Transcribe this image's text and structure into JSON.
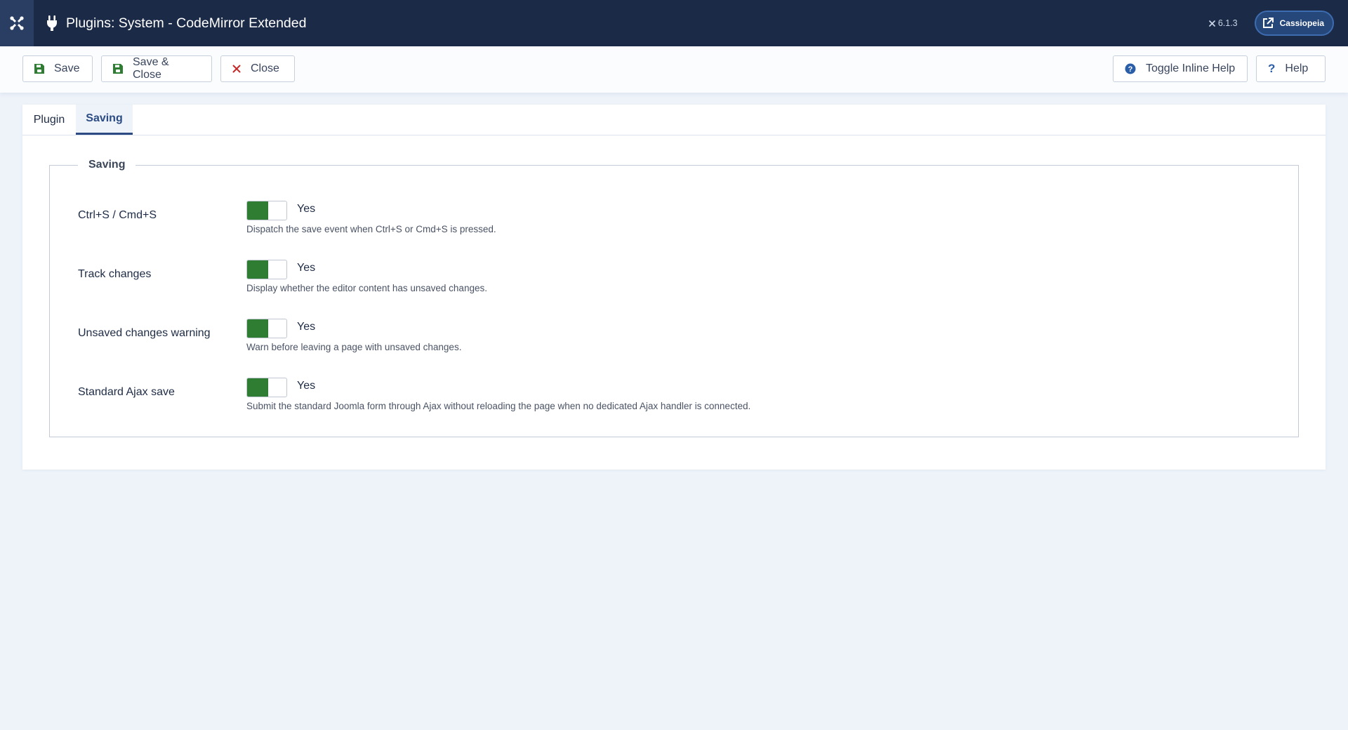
{
  "header": {
    "title": "Plugins: System - CodeMirror Extended",
    "version": "6.1.3",
    "site_name": "Cassiopeia",
    "icons": [
      "joomla-logo-icon",
      "plug-icon",
      "joomla-small-icon",
      "external-link-icon"
    ]
  },
  "toolbar": {
    "save_label": "Save",
    "save_close_label": "Save & Close",
    "close_label": "Close",
    "toggle_help_label": "Toggle Inline Help",
    "help_label": "Help"
  },
  "tabs": [
    {
      "label": "Plugin",
      "active": false
    },
    {
      "label": "Saving",
      "active": true
    }
  ],
  "fieldset": {
    "legend": "Saving",
    "fields": [
      {
        "label": "Ctrl+S / Cmd+S",
        "value": "Yes",
        "enabled": true,
        "description": "Dispatch the save event when Ctrl+S or Cmd+S is pressed."
      },
      {
        "label": "Track changes",
        "value": "Yes",
        "enabled": true,
        "description": "Display whether the editor content has unsaved changes."
      },
      {
        "label": "Unsaved changes warning",
        "value": "Yes",
        "enabled": true,
        "description": "Warn before leaving a page with unsaved changes."
      },
      {
        "label": "Standard Ajax save",
        "value": "Yes",
        "enabled": true,
        "description": "Submit the standard Joomla form through Ajax without reloading the page when no dedicated Ajax handler is connected."
      }
    ]
  },
  "colors": {
    "header_bg": "#1b2a47",
    "toggle_on": "#2e7d32",
    "accent": "#2b4b82",
    "close_red": "#c62828",
    "page_bg": "#eef3fa"
  }
}
